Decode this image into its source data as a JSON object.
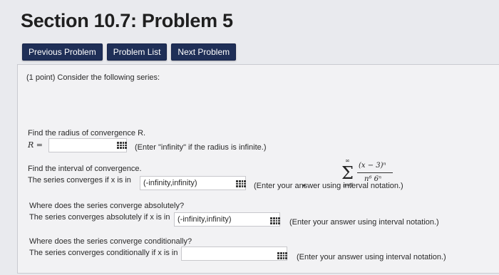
{
  "page": {
    "title": "Section 10.7: Problem 5"
  },
  "nav": {
    "previous_label": "Previous Problem",
    "list_label": "Problem List",
    "next_label": "Next Problem"
  },
  "problem": {
    "intro": "(1 point) Consider the following series:",
    "series": {
      "sum_upper": "∞",
      "sum_lower": "n=1",
      "numerator": "(x − 3)ⁿ",
      "denominator": "n⁶ 6ⁿ"
    },
    "radius": {
      "prompt": "Find the radius of convergence R.",
      "label": "R =",
      "value": "",
      "hint": "(Enter \"infinity\" if the radius is infinite.)"
    },
    "interval": {
      "prompt": "Find the interval of convergence.",
      "label": "The series converges if x is in",
      "value": "(-infinity,infinity)",
      "hint": "(Enter your answer using interval notation.)"
    },
    "absolute": {
      "prompt": "Where does the series converge absolutely?",
      "label": "The series converges absolutely if x is in",
      "value": "(-infinity,infinity)",
      "hint": "(Enter your answer using interval notation.)"
    },
    "conditional": {
      "prompt": "Where does the series converge conditionally?",
      "label": "The series converges conditionally if x is in",
      "value": "",
      "hint": "(Enter your answer using interval notation.)"
    }
  }
}
